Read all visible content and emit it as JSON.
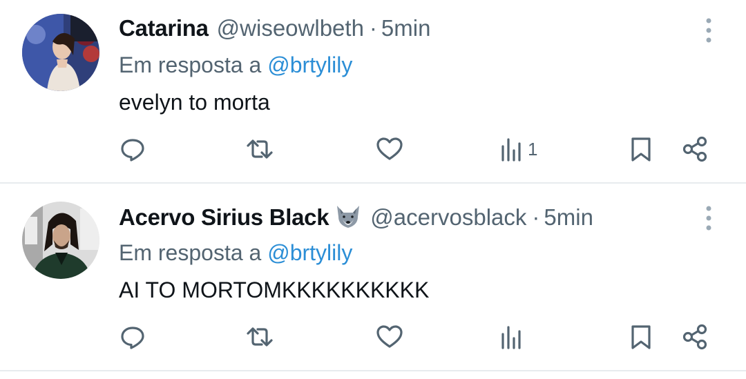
{
  "tweets": [
    {
      "display_name": "Catarina",
      "handle": "@wiseowlbeth",
      "separator": "·",
      "time": "5min",
      "reply_prefix": "Em resposta a",
      "reply_to": "@brtylily",
      "text": "evelyn to morta",
      "views_count": "1",
      "has_wolf_emoji": false
    },
    {
      "display_name": "Acervo Sirius Black",
      "handle": "@acervosblack",
      "separator": "·",
      "time": "5min",
      "reply_prefix": "Em resposta a",
      "reply_to": "@brtylily",
      "text": "AI TO MORTOMKKKKKKKKKK",
      "views_count": "",
      "has_wolf_emoji": true
    }
  ],
  "icons": {
    "more": "more-vertical-icon",
    "reply": "reply-icon",
    "retweet": "retweet-icon",
    "like": "like-icon",
    "views": "views-icon",
    "bookmark": "bookmark-icon",
    "share": "share-icon"
  },
  "colors": {
    "text": "#0f1419",
    "secondary": "#536471",
    "mention": "#2b8ed6",
    "divider": "#e7ebee"
  }
}
